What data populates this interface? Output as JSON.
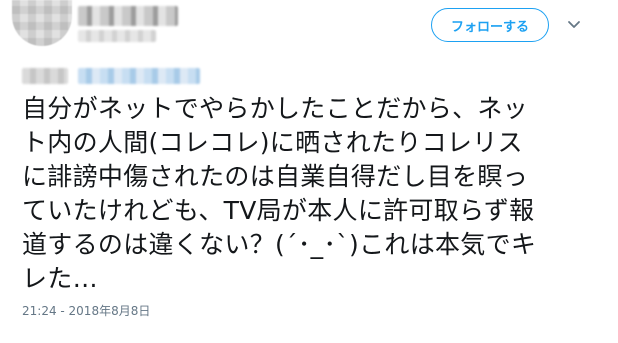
{
  "header": {
    "follow_button_label": "フォローする",
    "caret_icon": "chevron-down-icon"
  },
  "tweet": {
    "text_lines": [
      "自分がネットでやらかしたことだから、ネッ",
      "ト内の人間(コレコレ)に晒されたりコレリス",
      "に誹謗中傷されたのは自業自得だし目を瞑っ",
      "ていたけれども、TV局が本人に許可取らず報",
      "道するのは違くない？(´･_･`)これは本気でキ",
      "レた…"
    ],
    "timestamp": "21:24 - 2018年8月8日"
  },
  "colors": {
    "accent": "#1da1f2",
    "text": "#14171a",
    "muted": "#657786"
  }
}
